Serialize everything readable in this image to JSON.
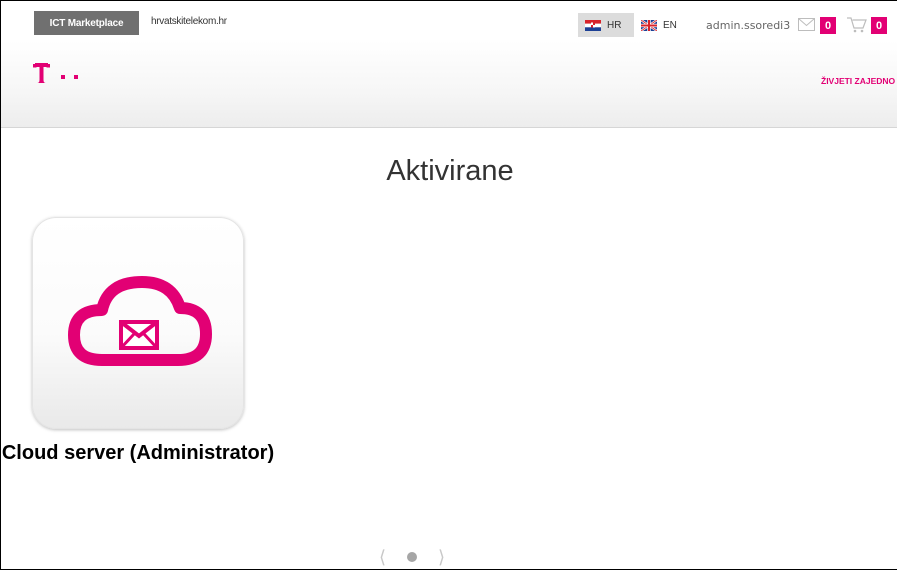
{
  "topbar": {
    "marketplace_label": "ICT Marketplace",
    "site_link": "hrvatskitelekom.hr",
    "languages": [
      {
        "code": "HR",
        "active": true
      },
      {
        "code": "EN",
        "active": false
      }
    ],
    "username": "admin.ssoredi3",
    "messages_count": "0",
    "cart_count": "0"
  },
  "header": {
    "logo_icon": "telekom-t-logo-icon",
    "slogan": "ŽIVJETI ZAJEDNO"
  },
  "main": {
    "title": "Aktivirane",
    "tiles": [
      {
        "label": "Cloud server (Administrator)",
        "icon": "cloud-mail-icon"
      }
    ]
  },
  "pager": {
    "prev_icon": "chevron-left-icon",
    "next_icon": "chevron-right-icon",
    "pages": 1,
    "current": 1
  },
  "colors": {
    "brand": "#e20074",
    "tab_bg": "#707070"
  }
}
